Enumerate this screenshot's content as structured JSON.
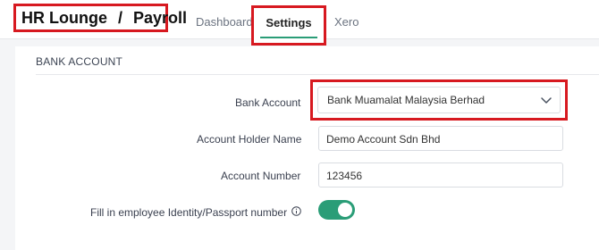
{
  "header": {
    "breadcrumb": {
      "root": "HR Lounge",
      "separator": "/",
      "current": "Payroll"
    },
    "tabs": {
      "dashboard": "Dashboard",
      "settings": "Settings",
      "xero": "Xero"
    },
    "active_tab": "settings"
  },
  "section": {
    "title": "BANK ACCOUNT",
    "fields": {
      "bank_account": {
        "label": "Bank Account",
        "value": "Bank Muamalat Malaysia Berhad"
      },
      "holder_name": {
        "label": "Account Holder Name",
        "value": "Demo Account Sdn Bhd"
      },
      "account_number": {
        "label": "Account Number",
        "value": "123456"
      },
      "fill_identity": {
        "label": "Fill in employee Identity/Passport number",
        "enabled": true
      }
    }
  },
  "icons": {
    "select_chevron": "chevron-down-icon",
    "info": "info-icon"
  },
  "colors": {
    "accent_green": "#2a9d77",
    "highlight_red": "#d71920"
  }
}
